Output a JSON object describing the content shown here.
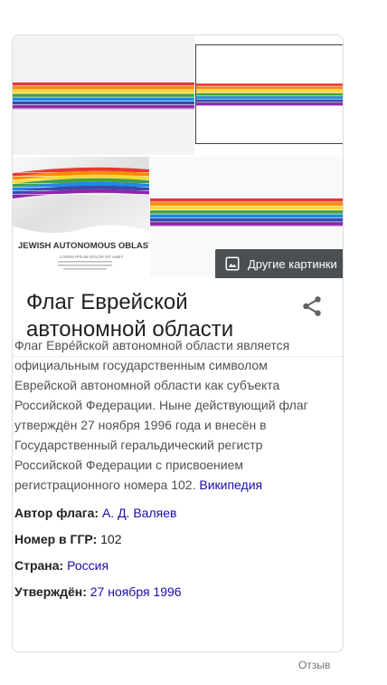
{
  "gallery": {
    "more_images_label": "Другие картинки",
    "image3_title": "JEWISH AUTONOMOUS OBLAST",
    "image3_subtitle": "LOREM IPSUM DOLOR SIT AMET",
    "flag_colors": [
      "#e53935",
      "#fb8c00",
      "#fdd835",
      "#43a047",
      "#1e88e5",
      "#3949ab",
      "#8e24aa"
    ]
  },
  "entity": {
    "title": "Флаг Еврейской автономной области"
  },
  "description": {
    "text": "Флаг Евре́йской автономной области является официальным государственным символом Еврейской автономной области как субъекта Российской Федерации. Ныне действующий флаг утверждён 27 ноября 1996 года и внесён в Государственный геральдический регистр Российской Федерации с присвоением регистрационного номера 102. ",
    "source_link": "Википедия"
  },
  "facts": [
    {
      "label": "Автор флага:",
      "value": "А. Д. Валяев",
      "link": true
    },
    {
      "label": "Номер в ГГР:",
      "value": "102",
      "link": false
    },
    {
      "label": "Страна:",
      "value": "Россия",
      "link": true
    },
    {
      "label": "Утверждён:",
      "value": "27 ноября 1996",
      "link": true
    }
  ],
  "footer": {
    "feedback_label": "Отзыв"
  }
}
